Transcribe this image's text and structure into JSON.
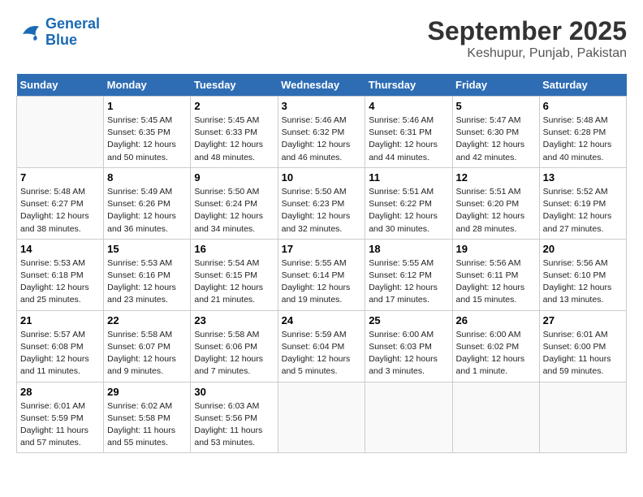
{
  "logo": {
    "line1": "General",
    "line2": "Blue"
  },
  "title": "September 2025",
  "subtitle": "Keshupur, Punjab, Pakistan",
  "days_of_week": [
    "Sunday",
    "Monday",
    "Tuesday",
    "Wednesday",
    "Thursday",
    "Friday",
    "Saturday"
  ],
  "weeks": [
    [
      {
        "day": "",
        "sunrise": "",
        "sunset": "",
        "daylight": ""
      },
      {
        "day": "1",
        "sunrise": "Sunrise: 5:45 AM",
        "sunset": "Sunset: 6:35 PM",
        "daylight": "Daylight: 12 hours and 50 minutes."
      },
      {
        "day": "2",
        "sunrise": "Sunrise: 5:45 AM",
        "sunset": "Sunset: 6:33 PM",
        "daylight": "Daylight: 12 hours and 48 minutes."
      },
      {
        "day": "3",
        "sunrise": "Sunrise: 5:46 AM",
        "sunset": "Sunset: 6:32 PM",
        "daylight": "Daylight: 12 hours and 46 minutes."
      },
      {
        "day": "4",
        "sunrise": "Sunrise: 5:46 AM",
        "sunset": "Sunset: 6:31 PM",
        "daylight": "Daylight: 12 hours and 44 minutes."
      },
      {
        "day": "5",
        "sunrise": "Sunrise: 5:47 AM",
        "sunset": "Sunset: 6:30 PM",
        "daylight": "Daylight: 12 hours and 42 minutes."
      },
      {
        "day": "6",
        "sunrise": "Sunrise: 5:48 AM",
        "sunset": "Sunset: 6:28 PM",
        "daylight": "Daylight: 12 hours and 40 minutes."
      }
    ],
    [
      {
        "day": "7",
        "sunrise": "Sunrise: 5:48 AM",
        "sunset": "Sunset: 6:27 PM",
        "daylight": "Daylight: 12 hours and 38 minutes."
      },
      {
        "day": "8",
        "sunrise": "Sunrise: 5:49 AM",
        "sunset": "Sunset: 6:26 PM",
        "daylight": "Daylight: 12 hours and 36 minutes."
      },
      {
        "day": "9",
        "sunrise": "Sunrise: 5:50 AM",
        "sunset": "Sunset: 6:24 PM",
        "daylight": "Daylight: 12 hours and 34 minutes."
      },
      {
        "day": "10",
        "sunrise": "Sunrise: 5:50 AM",
        "sunset": "Sunset: 6:23 PM",
        "daylight": "Daylight: 12 hours and 32 minutes."
      },
      {
        "day": "11",
        "sunrise": "Sunrise: 5:51 AM",
        "sunset": "Sunset: 6:22 PM",
        "daylight": "Daylight: 12 hours and 30 minutes."
      },
      {
        "day": "12",
        "sunrise": "Sunrise: 5:51 AM",
        "sunset": "Sunset: 6:20 PM",
        "daylight": "Daylight: 12 hours and 28 minutes."
      },
      {
        "day": "13",
        "sunrise": "Sunrise: 5:52 AM",
        "sunset": "Sunset: 6:19 PM",
        "daylight": "Daylight: 12 hours and 27 minutes."
      }
    ],
    [
      {
        "day": "14",
        "sunrise": "Sunrise: 5:53 AM",
        "sunset": "Sunset: 6:18 PM",
        "daylight": "Daylight: 12 hours and 25 minutes."
      },
      {
        "day": "15",
        "sunrise": "Sunrise: 5:53 AM",
        "sunset": "Sunset: 6:16 PM",
        "daylight": "Daylight: 12 hours and 23 minutes."
      },
      {
        "day": "16",
        "sunrise": "Sunrise: 5:54 AM",
        "sunset": "Sunset: 6:15 PM",
        "daylight": "Daylight: 12 hours and 21 minutes."
      },
      {
        "day": "17",
        "sunrise": "Sunrise: 5:55 AM",
        "sunset": "Sunset: 6:14 PM",
        "daylight": "Daylight: 12 hours and 19 minutes."
      },
      {
        "day": "18",
        "sunrise": "Sunrise: 5:55 AM",
        "sunset": "Sunset: 6:12 PM",
        "daylight": "Daylight: 12 hours and 17 minutes."
      },
      {
        "day": "19",
        "sunrise": "Sunrise: 5:56 AM",
        "sunset": "Sunset: 6:11 PM",
        "daylight": "Daylight: 12 hours and 15 minutes."
      },
      {
        "day": "20",
        "sunrise": "Sunrise: 5:56 AM",
        "sunset": "Sunset: 6:10 PM",
        "daylight": "Daylight: 12 hours and 13 minutes."
      }
    ],
    [
      {
        "day": "21",
        "sunrise": "Sunrise: 5:57 AM",
        "sunset": "Sunset: 6:08 PM",
        "daylight": "Daylight: 12 hours and 11 minutes."
      },
      {
        "day": "22",
        "sunrise": "Sunrise: 5:58 AM",
        "sunset": "Sunset: 6:07 PM",
        "daylight": "Daylight: 12 hours and 9 minutes."
      },
      {
        "day": "23",
        "sunrise": "Sunrise: 5:58 AM",
        "sunset": "Sunset: 6:06 PM",
        "daylight": "Daylight: 12 hours and 7 minutes."
      },
      {
        "day": "24",
        "sunrise": "Sunrise: 5:59 AM",
        "sunset": "Sunset: 6:04 PM",
        "daylight": "Daylight: 12 hours and 5 minutes."
      },
      {
        "day": "25",
        "sunrise": "Sunrise: 6:00 AM",
        "sunset": "Sunset: 6:03 PM",
        "daylight": "Daylight: 12 hours and 3 minutes."
      },
      {
        "day": "26",
        "sunrise": "Sunrise: 6:00 AM",
        "sunset": "Sunset: 6:02 PM",
        "daylight": "Daylight: 12 hours and 1 minute."
      },
      {
        "day": "27",
        "sunrise": "Sunrise: 6:01 AM",
        "sunset": "Sunset: 6:00 PM",
        "daylight": "Daylight: 11 hours and 59 minutes."
      }
    ],
    [
      {
        "day": "28",
        "sunrise": "Sunrise: 6:01 AM",
        "sunset": "Sunset: 5:59 PM",
        "daylight": "Daylight: 11 hours and 57 minutes."
      },
      {
        "day": "29",
        "sunrise": "Sunrise: 6:02 AM",
        "sunset": "Sunset: 5:58 PM",
        "daylight": "Daylight: 11 hours and 55 minutes."
      },
      {
        "day": "30",
        "sunrise": "Sunrise: 6:03 AM",
        "sunset": "Sunset: 5:56 PM",
        "daylight": "Daylight: 11 hours and 53 minutes."
      },
      {
        "day": "",
        "sunrise": "",
        "sunset": "",
        "daylight": ""
      },
      {
        "day": "",
        "sunrise": "",
        "sunset": "",
        "daylight": ""
      },
      {
        "day": "",
        "sunrise": "",
        "sunset": "",
        "daylight": ""
      },
      {
        "day": "",
        "sunrise": "",
        "sunset": "",
        "daylight": ""
      }
    ]
  ]
}
